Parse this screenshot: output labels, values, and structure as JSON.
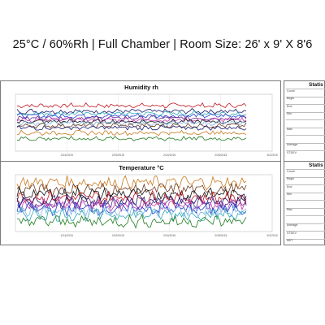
{
  "header": {
    "title": "25°C / 60%Rh | Full Chamber | Room Size: 26' x 9' X 8'6"
  },
  "stats_panel": {
    "title": "Statis",
    "rows_top": [
      "Count",
      "Begin",
      "End",
      "Min",
      "",
      "Max",
      "",
      "Average",
      "STDEV"
    ],
    "rows_bottom": [
      "Count",
      "Begin",
      "End",
      "Min",
      "",
      "Max",
      "",
      "Average",
      "STDEV",
      "MKT"
    ]
  },
  "colors": {
    "red": "#c0141e",
    "navy": "#17186b",
    "teal": "#2aa7b8",
    "blue": "#1e3fd0",
    "purple": "#6a2a8a",
    "black": "#111111",
    "green": "#1f7a1f",
    "orange": "#c9781e",
    "lightblue": "#7fb3e6",
    "magenta": "#c236b0",
    "gray": "#777777",
    "brown": "#6b3a1e"
  },
  "chart_data": [
    {
      "type": "line",
      "title": "Humidity rh",
      "x_ticks": [
        "",
        "2/14/2015",
        "2/19/2015",
        "2/24/2015",
        "2/28/2015",
        "3/2/2015"
      ],
      "series": [
        {
          "color": "red",
          "level": 0.8
        },
        {
          "color": "navy",
          "level": 0.7
        },
        {
          "color": "teal",
          "level": 0.66
        },
        {
          "color": "blue",
          "level": 0.62
        },
        {
          "color": "purple",
          "level": 0.58
        },
        {
          "color": "magenta",
          "level": 0.55
        },
        {
          "color": "black",
          "level": 0.52
        },
        {
          "color": "lightblue",
          "level": 0.49
        },
        {
          "color": "brown",
          "level": 0.45
        },
        {
          "color": "navy",
          "level": 0.41
        },
        {
          "color": "orange",
          "level": 0.32
        },
        {
          "color": "green",
          "level": 0.22
        }
      ],
      "noise": 0.035
    },
    {
      "type": "line",
      "title": "Temperature °C",
      "x_ticks": [
        "",
        "2/14/2015",
        "2/19/2015",
        "2/24/2015",
        "2/28/2015",
        "3/2/2015"
      ],
      "series": [
        {
          "color": "orange",
          "level": 0.86
        },
        {
          "color": "brown",
          "level": 0.74
        },
        {
          "color": "black",
          "level": 0.66
        },
        {
          "color": "red",
          "level": 0.6
        },
        {
          "color": "navy",
          "level": 0.54
        },
        {
          "color": "purple",
          "level": 0.5
        },
        {
          "color": "magenta",
          "level": 0.46
        },
        {
          "color": "blue",
          "level": 0.4
        },
        {
          "color": "lightblue",
          "level": 0.36
        },
        {
          "color": "teal",
          "level": 0.3
        },
        {
          "color": "green",
          "level": 0.18
        }
      ],
      "noise": 0.09
    }
  ]
}
